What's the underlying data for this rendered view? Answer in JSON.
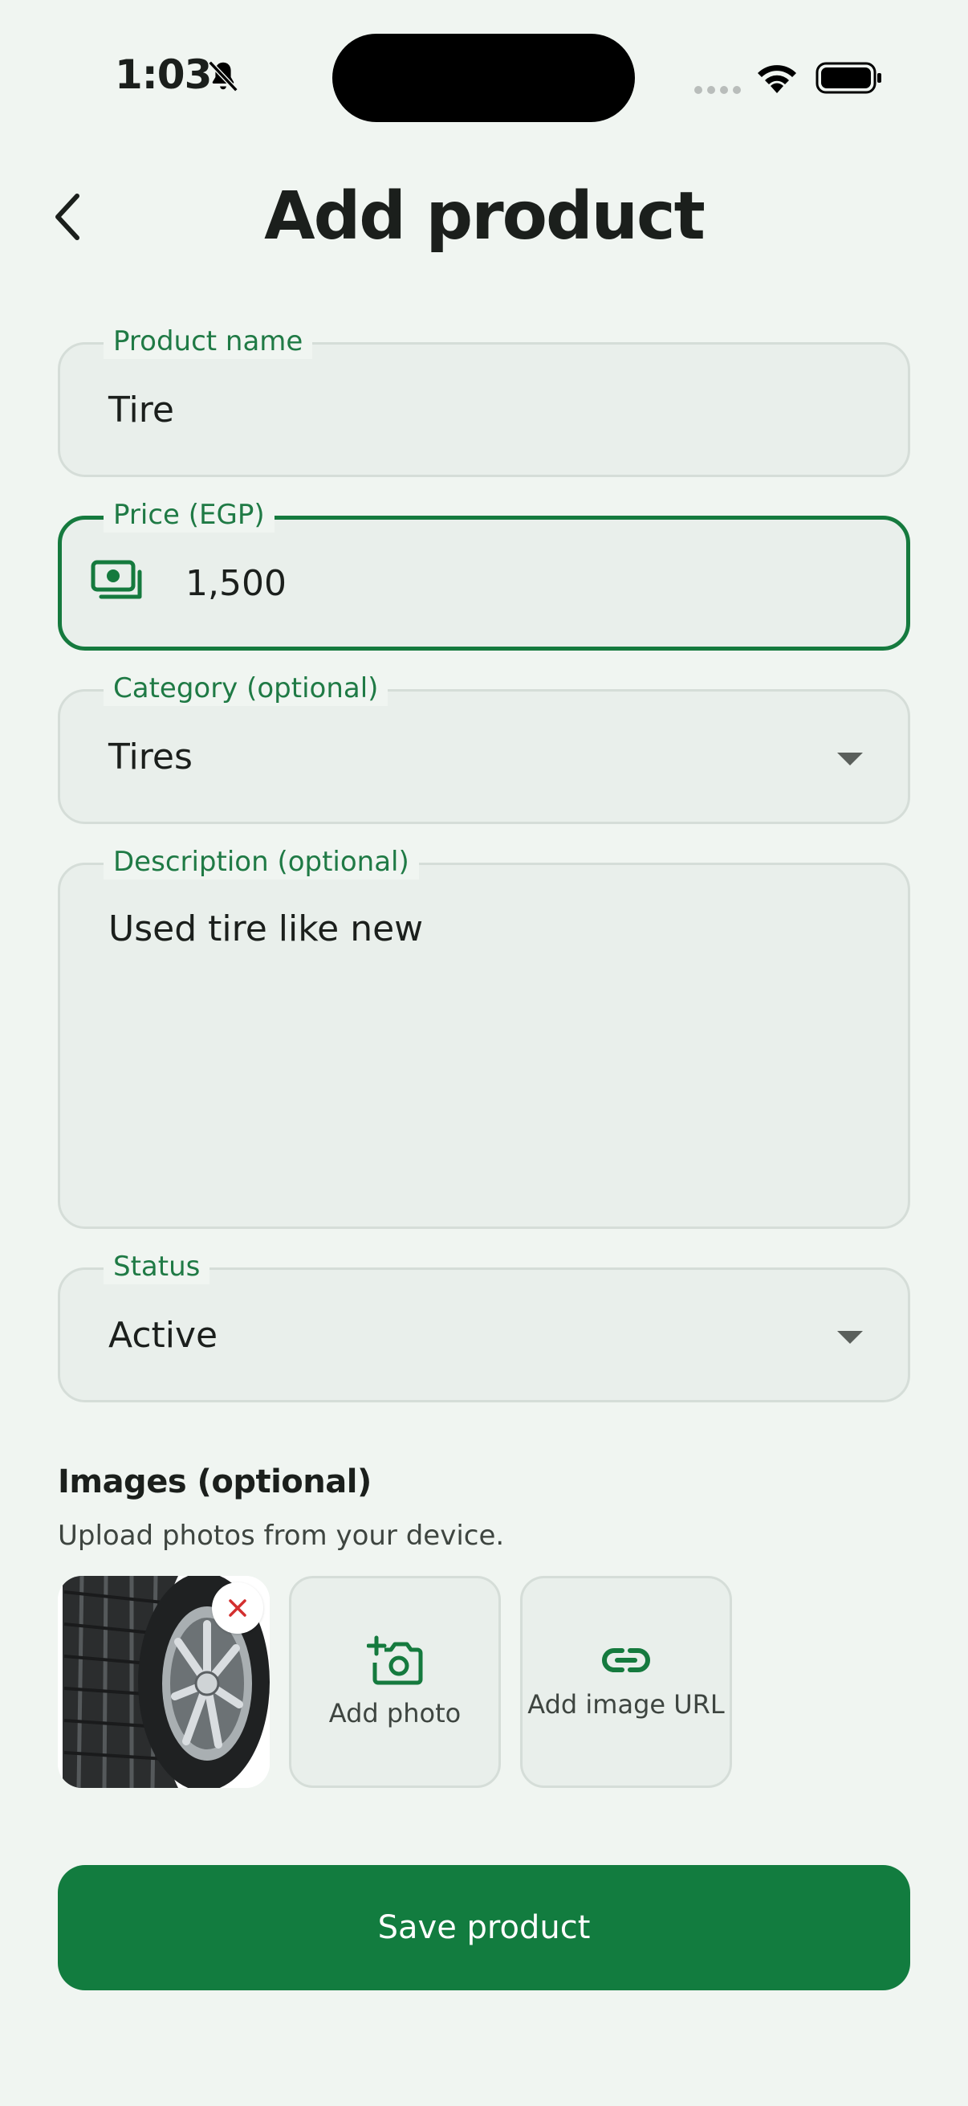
{
  "status_bar": {
    "time": "1:03",
    "icons": [
      "bell-slash-icon",
      "signal-dots-icon",
      "wifi-icon",
      "battery-icon"
    ]
  },
  "header": {
    "back_icon": "chevron-left-icon",
    "title": "Add product"
  },
  "form": {
    "product_name": {
      "label": "Product name",
      "value": "Tire"
    },
    "price": {
      "label": "Price (EGP)",
      "value": "1,500",
      "icon": "money-icon"
    },
    "category": {
      "label": "Category (optional)",
      "value": "Tires"
    },
    "description": {
      "label": "Description (optional)",
      "value": "Used tire like new"
    },
    "status": {
      "label": "Status",
      "value": "Active"
    }
  },
  "images": {
    "title": "Images (optional)",
    "subtitle": "Upload photos from your device.",
    "add_photo_label": "Add photo",
    "add_url_label": "Add image URL"
  },
  "actions": {
    "save_label": "Save product"
  },
  "colors": {
    "accent": "#127c3f",
    "label": "#1f7a45",
    "background": "#f0f5f1",
    "field_bg": "#e9efeb",
    "remove": "#d32f2f"
  }
}
